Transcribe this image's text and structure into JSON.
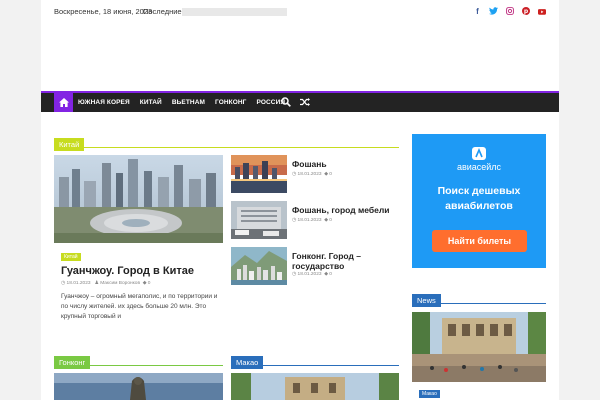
{
  "topbar": {
    "date": "Воскресенье, 18 июня, 2023",
    "latest_label": "Последние:"
  },
  "social": [
    "facebook-icon",
    "twitter-icon",
    "instagram-icon",
    "pinterest-icon",
    "youtube-icon"
  ],
  "nav": {
    "items": [
      "ЮЖНАЯ КОРЕЯ",
      "КИТАЙ",
      "ВЬЕТНАМ",
      "ГОНКОНГ",
      "РОССИЯ"
    ]
  },
  "sections": {
    "china": "Китай",
    "hongkong": "Гонконг",
    "macau": "Макао",
    "news": "News"
  },
  "colors": {
    "accent": "#8224e3",
    "china": "#c7dc1f",
    "hongkong": "#7ac943",
    "blue": "#2a6ebb",
    "ad_bg": "#1e9af5",
    "ad_button": "#ff6e2e"
  },
  "featured": {
    "tag": "Китай",
    "title": "Гуанчжоу. Город в Китае",
    "date": "18.01.2023",
    "author": "Максим Воронков",
    "comments": "0",
    "excerpt": "Гуанчжоу – огромный мегаполис, и по территории и по числу жителей. их здесь больше 20 млн. Это крупный торговый и"
  },
  "side_posts": [
    {
      "title": "Фошань",
      "date": "18.01.2023",
      "comments": "0"
    },
    {
      "title": "Фошань, город мебели",
      "date": "18.01.2023",
      "comments": "0"
    },
    {
      "title": "Гонконг. Город – государство",
      "date": "18.01.2023",
      "comments": "0"
    }
  ],
  "ad": {
    "brand": "авиасейлс",
    "headline": "Поиск дешевых авиабилетов",
    "button": "Найти билеты"
  },
  "news_tag": "Макао"
}
